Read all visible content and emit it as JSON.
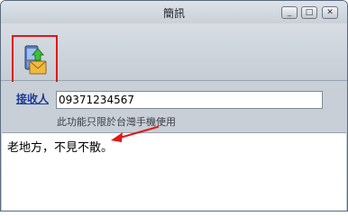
{
  "window": {
    "title": "簡訊"
  },
  "window_controls": {
    "minimize": "_",
    "maximize": "□",
    "close": "✕"
  },
  "toolbar": {
    "send_label": "發送",
    "send_icon": "send-phone-icon"
  },
  "form": {
    "recipient_label": "接收人",
    "recipient_value": "09371234567",
    "hint": "此功能只限於台灣手機使用"
  },
  "message": {
    "text": "老地方，不見不散。"
  },
  "annotation": {
    "highlight_color": "#e01818"
  }
}
